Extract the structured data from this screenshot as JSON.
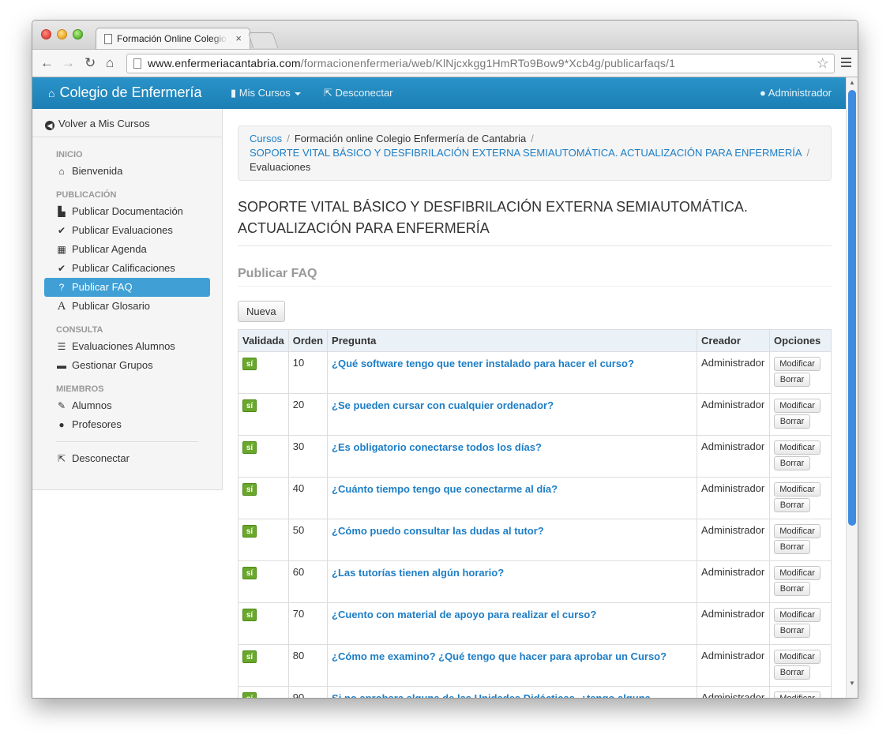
{
  "browser": {
    "tab_title": "Formación Online Colegio",
    "tab_close": "×",
    "url_host": "www.enfermeriacantabria.com",
    "url_path": "/formacionenfermeria/web/KlNjcxkgg1HmRTo9Bow9*Xcb4g/publicarfaqs/1"
  },
  "navbar": {
    "brand": "Colegio de Enfermería",
    "mis_cursos": "Mis Cursos",
    "desconectar": "Desconectar",
    "user": "Administrador"
  },
  "sidebar": {
    "back": "Volver a Mis Cursos",
    "groups": [
      {
        "header": "INICIO",
        "items": [
          {
            "label": "Bienvenida",
            "icon": "home-icon"
          }
        ]
      },
      {
        "header": "PUBLICACIÓN",
        "items": [
          {
            "label": "Publicar Documentación",
            "icon": "file-icon"
          },
          {
            "label": "Publicar Evaluaciones",
            "icon": "check-icon"
          },
          {
            "label": "Publicar Agenda",
            "icon": "calendar-icon"
          },
          {
            "label": "Publicar Calificaciones",
            "icon": "check-icon"
          },
          {
            "label": "Publicar FAQ",
            "icon": "question-icon"
          },
          {
            "label": "Publicar Glosario",
            "icon": "font-icon"
          }
        ]
      },
      {
        "header": "CONSULTA",
        "items": [
          {
            "label": "Evaluaciones Alumnos",
            "icon": "list-icon"
          },
          {
            "label": "Gestionar Grupos",
            "icon": "briefcase-icon"
          }
        ]
      },
      {
        "header": "MIEMBROS",
        "items": [
          {
            "label": "Alumnos",
            "icon": "pencil-icon"
          },
          {
            "label": "Profesores",
            "icon": "user-icon"
          }
        ]
      }
    ],
    "logout": "Desconectar",
    "active": "Publicar FAQ"
  },
  "breadcrumb": {
    "crumb1": "Cursos",
    "crumb2": "Formación online Colegio Enfermería de Cantabria",
    "crumb3": "SOPORTE VITAL BÁSICO Y DESFIBRILACIÓN EXTERNA SEMIAUTOMÁTICA. ACTUALIZACIÓN PARA ENFERMERÍA",
    "crumb4": "Evaluaciones",
    "separator": "/"
  },
  "course_title": "SOPORTE VITAL BÁSICO Y DESFIBRILACIÓN EXTERNA SEMIAUTOMÁTICA. ACTUALIZACIÓN PARA ENFERMERÍA",
  "section_title": "Publicar FAQ",
  "new_button": "Nueva",
  "table": {
    "headers": {
      "validada": "Validada",
      "orden": "Orden",
      "pregunta": "Pregunta",
      "creador": "Creador",
      "opciones": "Opciones"
    },
    "modify_label": "Modificar",
    "delete_label": "Borrar",
    "rows": [
      {
        "validada": "sí",
        "orden": "10",
        "pregunta": "¿Qué software tengo que tener instalado para hacer el curso?",
        "creador": "Administrador"
      },
      {
        "validada": "sí",
        "orden": "20",
        "pregunta": "¿Se pueden cursar con cualquier ordenador?",
        "creador": "Administrador"
      },
      {
        "validada": "sí",
        "orden": "30",
        "pregunta": "¿Es obligatorio conectarse todos los días?",
        "creador": "Administrador"
      },
      {
        "validada": "sí",
        "orden": "40",
        "pregunta": "¿Cuánto tiempo tengo que conectarme al día?",
        "creador": "Administrador"
      },
      {
        "validada": "sí",
        "orden": "50",
        "pregunta": "¿Cómo puedo consultar las dudas al tutor?",
        "creador": "Administrador"
      },
      {
        "validada": "sí",
        "orden": "60",
        "pregunta": "¿Las tutorías tienen algún horario?",
        "creador": "Administrador"
      },
      {
        "validada": "sí",
        "orden": "70",
        "pregunta": "¿Cuento con material de apoyo para realizar el curso?",
        "creador": "Administrador"
      },
      {
        "validada": "sí",
        "orden": "80",
        "pregunta": "¿Cómo me examino? ¿Qué tengo que hacer para aprobar un Curso?",
        "creador": "Administrador"
      },
      {
        "validada": "sí",
        "orden": "90",
        "pregunta": "Si no aprobara alguna de las Unidades Didácticas, ¿tengo alguna posibilidad de recuperarla?",
        "creador": "Administrador"
      }
    ]
  },
  "colors": {
    "navbar": "#1f86bc",
    "link": "#1d7ec6",
    "active_item": "#40a0d6",
    "badge": "#6aa82c"
  }
}
